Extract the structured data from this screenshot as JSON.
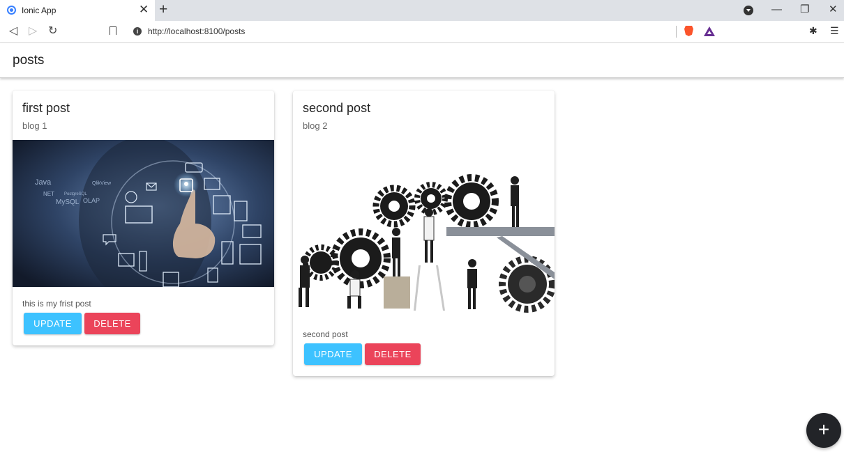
{
  "browser": {
    "tab_title": "Ionic App",
    "tab_close": "✕",
    "new_tab": "+",
    "window_controls": {
      "minimize": "—",
      "restore": "❐",
      "close": "✕"
    },
    "url": "http://localhost:8100/posts",
    "nav": {
      "back": "◁",
      "forward": "▷",
      "reload": "↻"
    },
    "extensions_icon": "✱",
    "menu_icon": "☰"
  },
  "app": {
    "title": "posts",
    "fab_label": "+"
  },
  "posts": [
    {
      "title": "first post",
      "subtitle": "blog 1",
      "content": "this is my frist post",
      "image_tech_labels": [
        "Java",
        "NET",
        "MySQL",
        "OLAP",
        "QlikView",
        "PostgreSQL"
      ],
      "update_label": "UPDATE",
      "delete_label": "DELETE"
    },
    {
      "title": "second post",
      "subtitle": "blog 2",
      "content": "second post",
      "update_label": "UPDATE",
      "delete_label": "DELETE"
    }
  ],
  "colors": {
    "primary_update": "#3dc2ff",
    "danger_delete": "#eb445a",
    "fab": "#222428",
    "tab_strip": "#dee1e6"
  }
}
